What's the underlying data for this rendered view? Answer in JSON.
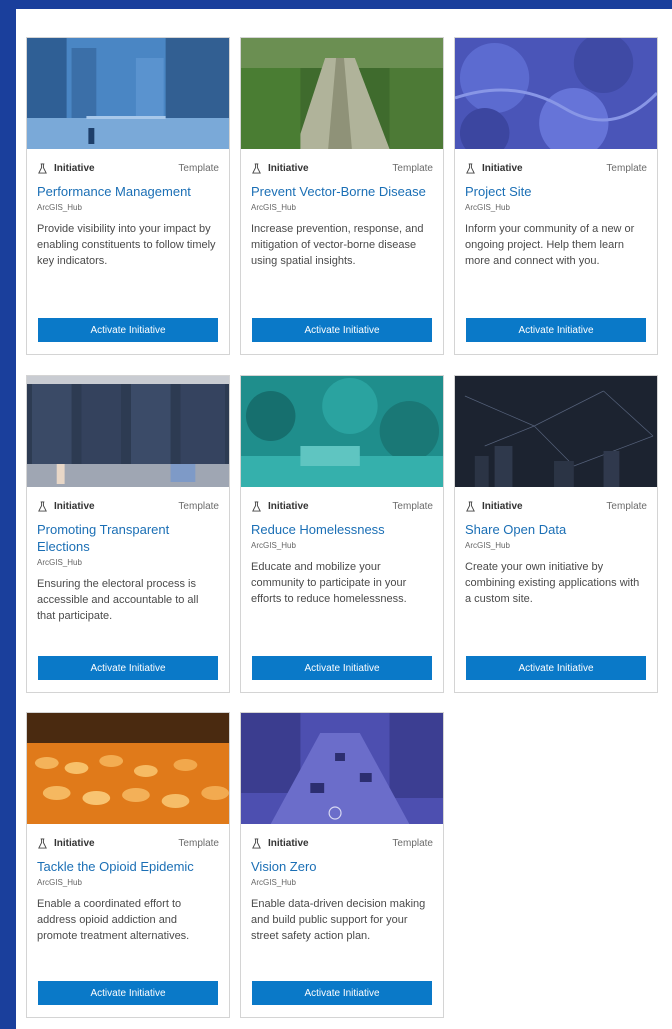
{
  "cards": [
    {
      "type": "Initiative",
      "badge": "Template",
      "title": "Performance Management",
      "owner": "ArcGIS_Hub",
      "description": "Provide visibility into your impact by enabling constituents to follow timely key indicators.",
      "button": "Activate Initiative"
    },
    {
      "type": "Initiative",
      "badge": "Template",
      "title": "Prevent Vector-Borne Disease",
      "owner": "ArcGIS_Hub",
      "description": "Increase prevention, response, and mitigation of vector-borne disease using spatial insights.",
      "button": "Activate Initiative"
    },
    {
      "type": "Initiative",
      "badge": "Template",
      "title": "Project Site",
      "owner": "ArcGIS_Hub",
      "description": "Inform your community of a new or ongoing project. Help them learn more and connect with you.",
      "button": "Activate Initiative"
    },
    {
      "type": "Initiative",
      "badge": "Template",
      "title": "Promoting Transparent Elections",
      "owner": "ArcGIS_Hub",
      "description": "Ensuring the electoral process is accessible and accountable to all that participate.",
      "button": "Activate Initiative"
    },
    {
      "type": "Initiative",
      "badge": "Template",
      "title": "Reduce Homelessness",
      "owner": "ArcGIS_Hub",
      "description": "Educate and mobilize your community to participate in your efforts to reduce homelessness.",
      "button": "Activate Initiative"
    },
    {
      "type": "Initiative",
      "badge": "Template",
      "title": "Share Open Data",
      "owner": "ArcGIS_Hub",
      "description": "Create your own initiative by combining existing applications with a custom site.",
      "button": "Activate Initiative"
    },
    {
      "type": "Initiative",
      "badge": "Template",
      "title": "Tackle the Opioid Epidemic",
      "owner": "ArcGIS_Hub",
      "description": "Enable a coordinated effort to address opioid addiction and promote treatment alternatives.",
      "button": "Activate Initiative"
    },
    {
      "type": "Initiative",
      "badge": "Template",
      "title": "Vision Zero",
      "owner": "ArcGIS_Hub",
      "description": "Enable data-driven decision making and build public support for your street safety action plan.",
      "button": "Activate Initiative"
    }
  ],
  "colors": {
    "background": "#1a3f9c",
    "link": "#1b6fb5",
    "button": "#0a79c8"
  },
  "icons": {
    "type_icon": "flask-icon"
  }
}
